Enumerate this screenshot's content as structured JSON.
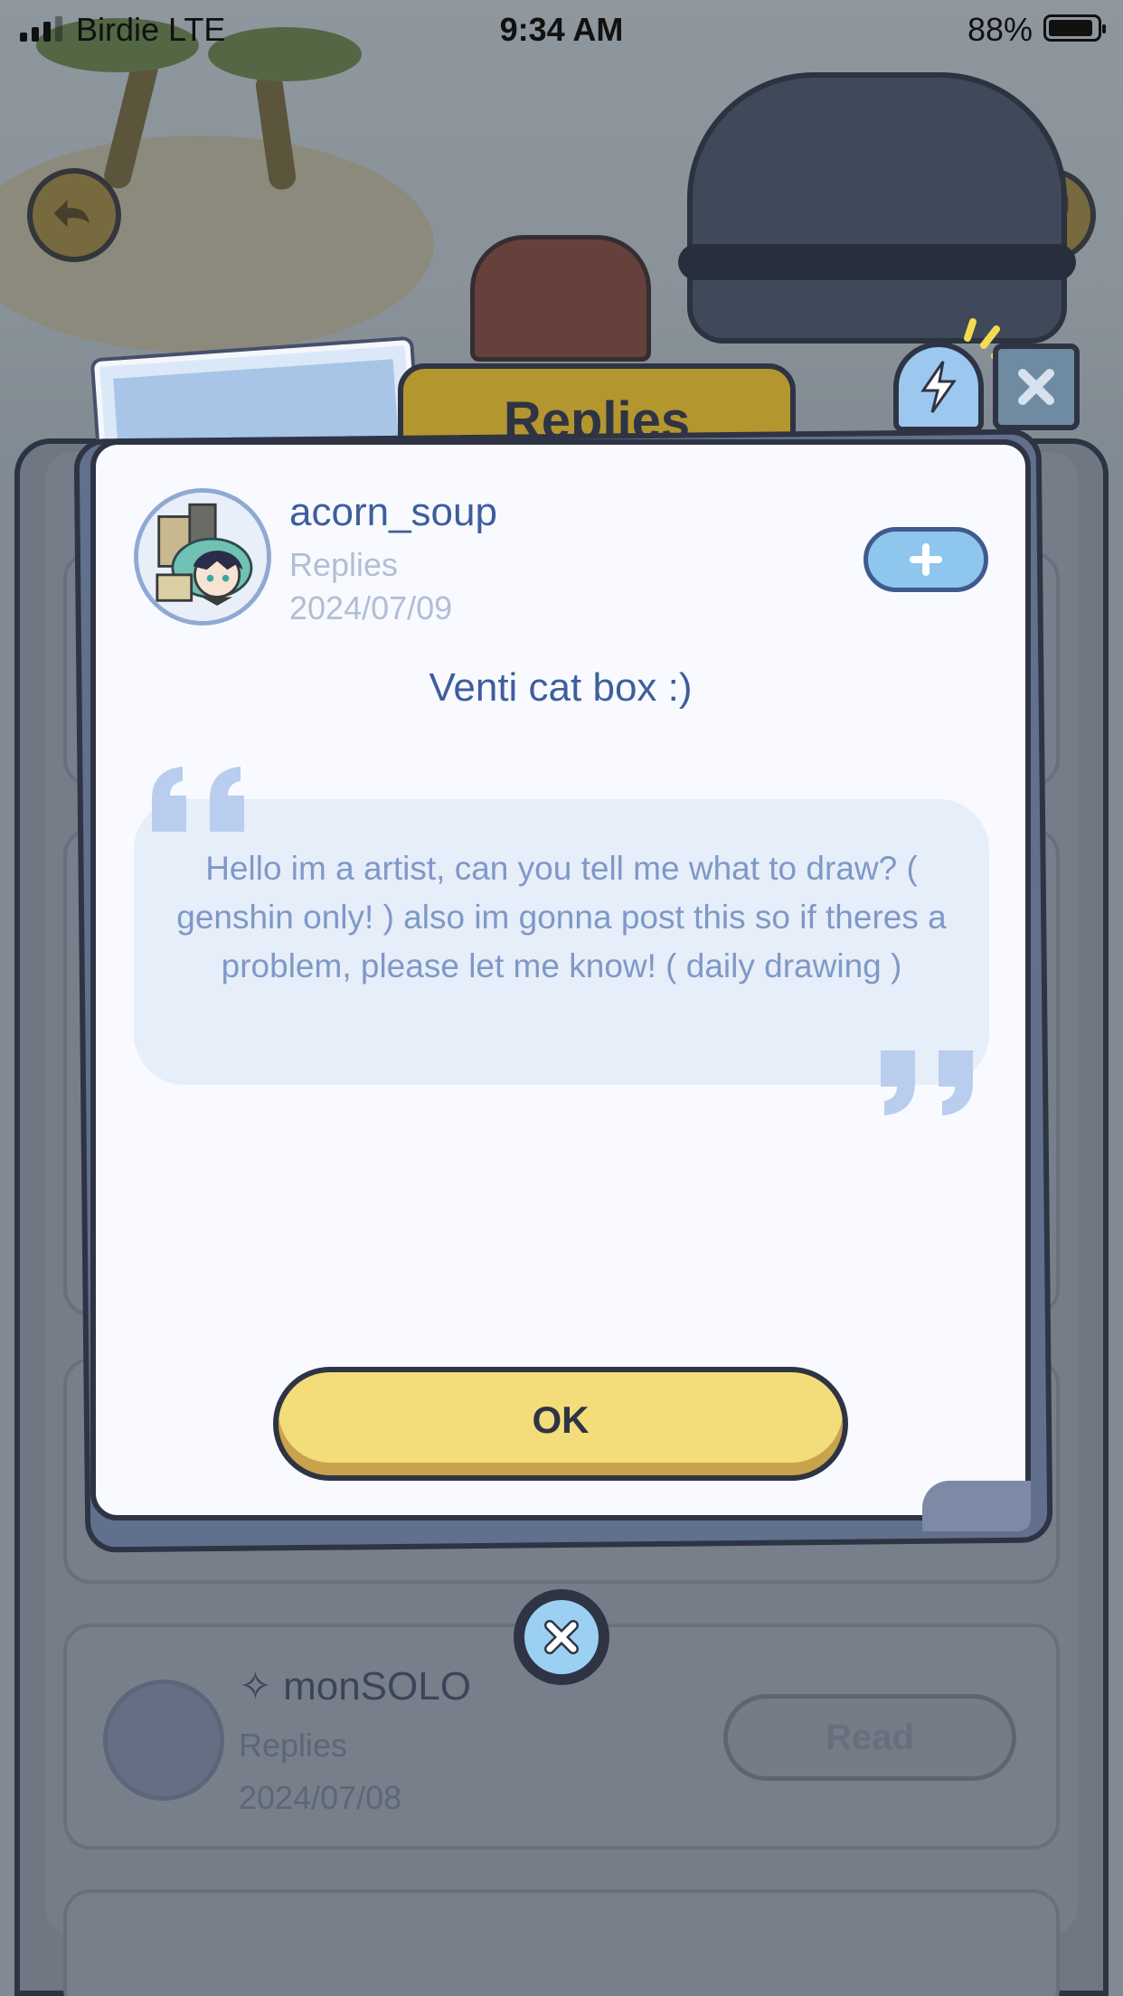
{
  "status_bar": {
    "carrier": "Birdie  LTE",
    "time": "9:34 AM",
    "battery": "88%"
  },
  "background": {
    "entry": {
      "name": "✧ monSOLO",
      "type": "Replies",
      "date": "2024/07/08",
      "read_label": "Read"
    }
  },
  "dialog": {
    "tab_title": "Replies",
    "user": {
      "name": "acorn_soup",
      "type": "Replies",
      "date": "2024/07/09"
    },
    "post_title": "Venti cat box :)",
    "message": "Hello im a artist, can you tell me what to draw? ( genshin only! ) also im gonna post this so if theres a problem, please let me know! ( daily drawing )",
    "ok_label": "OK"
  },
  "icons": {
    "back": "back-arrow-icon",
    "share": "share-icon",
    "lightning": "lightning-icon",
    "tab_close": "close-x-icon",
    "follow": "plus-icon",
    "dialog_close": "close-x-icon",
    "quote_open": "open-quote-icon",
    "quote_close": "close-quote-icon"
  },
  "colors": {
    "accent_blue": "#3e5e9c",
    "ok_yellow": "#f3dc7a",
    "outline": "#2f3444",
    "quote_bg": "#e6eefa"
  }
}
